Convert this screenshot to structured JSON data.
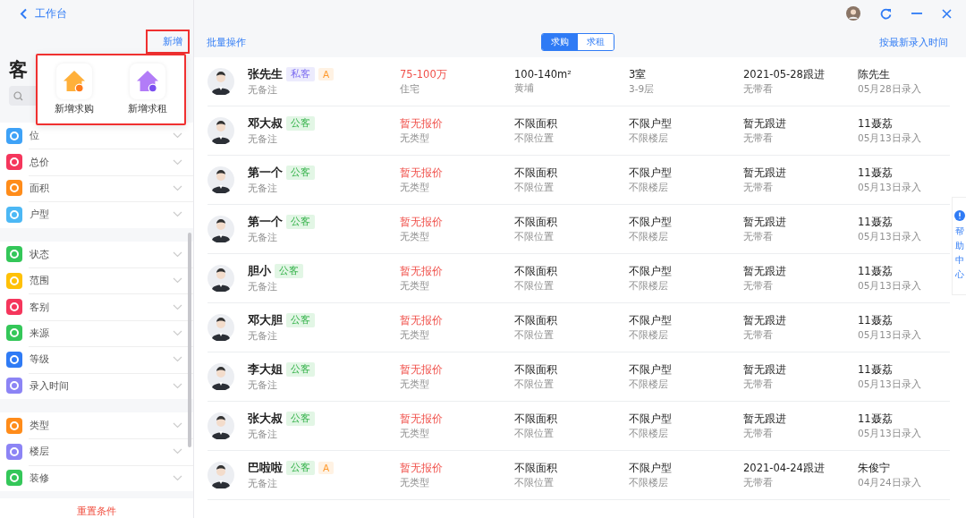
{
  "back": {
    "label": "工作台"
  },
  "sidebar": {
    "add_button": "新增",
    "title": "客",
    "filter_groups": [
      [
        {
          "label": "位",
          "color": "#3ea2f7"
        },
        {
          "label": "总价",
          "color": "#f5365c"
        },
        {
          "label": "面积",
          "color": "#ff8c1a"
        },
        {
          "label": "户型",
          "color": "#4cb8f5"
        }
      ],
      [
        {
          "label": "状态",
          "color": "#34c759"
        },
        {
          "label": "范围",
          "color": "#ffc107"
        },
        {
          "label": "客别",
          "color": "#f5365c"
        },
        {
          "label": "来源",
          "color": "#34c759"
        },
        {
          "label": "等级",
          "color": "#2f7bf5"
        },
        {
          "label": "录入时间",
          "color": "#8c84f5"
        }
      ],
      [
        {
          "label": "类型",
          "color": "#ff8c1a"
        },
        {
          "label": "楼层",
          "color": "#8c84f5"
        },
        {
          "label": "装修",
          "color": "#34c759"
        }
      ]
    ],
    "reset": "重置条件"
  },
  "popup": {
    "items": [
      {
        "label": "新增求购",
        "kind": "buy"
      },
      {
        "label": "新增求租",
        "kind": "rent"
      }
    ]
  },
  "toolbar": {
    "batch": "批量操作",
    "tabs": [
      {
        "label": "求购",
        "selected": true
      },
      {
        "label": "求租",
        "selected": false
      }
    ],
    "sort": "按最新录入时间"
  },
  "rows": [
    {
      "name": "张先生",
      "tags": [
        {
          "label": "私客",
          "kind": "private"
        },
        {
          "label": "A",
          "kind": "grade"
        }
      ],
      "note": "无备注",
      "price": "75-100万",
      "price_sub": "住宅",
      "area": "100-140m²",
      "area_sub": "黄埔",
      "rooms": "3室",
      "floors": "3-9层",
      "follow": "2021-05-28跟进",
      "follow_sub": "无带看",
      "owner": "陈先生",
      "date": "05月28日录入"
    },
    {
      "name": "邓大叔",
      "tags": [
        {
          "label": "公客",
          "kind": "public"
        }
      ],
      "note": "无备注",
      "price": "暂无报价",
      "price_sub": "无类型",
      "area": "不限面积",
      "area_sub": "不限位置",
      "rooms": "不限户型",
      "floors": "不限楼层",
      "follow": "暂无跟进",
      "follow_sub": "无带看",
      "owner": "11聂荔",
      "date": "05月13日录入"
    },
    {
      "name": "第一个",
      "tags": [
        {
          "label": "公客",
          "kind": "public"
        }
      ],
      "note": "无备注",
      "price": "暂无报价",
      "price_sub": "无类型",
      "area": "不限面积",
      "area_sub": "不限位置",
      "rooms": "不限户型",
      "floors": "不限楼层",
      "follow": "暂无跟进",
      "follow_sub": "无带看",
      "owner": "11聂荔",
      "date": "05月13日录入"
    },
    {
      "name": "第一个",
      "tags": [
        {
          "label": "公客",
          "kind": "public"
        }
      ],
      "note": "无备注",
      "price": "暂无报价",
      "price_sub": "无类型",
      "area": "不限面积",
      "area_sub": "不限位置",
      "rooms": "不限户型",
      "floors": "不限楼层",
      "follow": "暂无跟进",
      "follow_sub": "无带看",
      "owner": "11聂荔",
      "date": "05月13日录入"
    },
    {
      "name": "胆小",
      "tags": [
        {
          "label": "公客",
          "kind": "public"
        }
      ],
      "note": "无备注",
      "price": "暂无报价",
      "price_sub": "无类型",
      "area": "不限面积",
      "area_sub": "不限位置",
      "rooms": "不限户型",
      "floors": "不限楼层",
      "follow": "暂无跟进",
      "follow_sub": "无带看",
      "owner": "11聂荔",
      "date": "05月13日录入"
    },
    {
      "name": "邓大胆",
      "tags": [
        {
          "label": "公客",
          "kind": "public"
        }
      ],
      "note": "无备注",
      "price": "暂无报价",
      "price_sub": "无类型",
      "area": "不限面积",
      "area_sub": "不限位置",
      "rooms": "不限户型",
      "floors": "不限楼层",
      "follow": "暂无跟进",
      "follow_sub": "无带看",
      "owner": "11聂荔",
      "date": "05月13日录入"
    },
    {
      "name": "李大姐",
      "tags": [
        {
          "label": "公客",
          "kind": "public"
        }
      ],
      "note": "无备注",
      "price": "暂无报价",
      "price_sub": "无类型",
      "area": "不限面积",
      "area_sub": "不限位置",
      "rooms": "不限户型",
      "floors": "不限楼层",
      "follow": "暂无跟进",
      "follow_sub": "无带看",
      "owner": "11聂荔",
      "date": "05月13日录入"
    },
    {
      "name": "张大叔",
      "tags": [
        {
          "label": "公客",
          "kind": "public"
        }
      ],
      "note": "无备注",
      "price": "暂无报价",
      "price_sub": "无类型",
      "area": "不限面积",
      "area_sub": "不限位置",
      "rooms": "不限户型",
      "floors": "不限楼层",
      "follow": "暂无跟进",
      "follow_sub": "无带看",
      "owner": "11聂荔",
      "date": "05月13日录入"
    },
    {
      "name": "巴啦啦",
      "tags": [
        {
          "label": "公客",
          "kind": "public"
        },
        {
          "label": "A",
          "kind": "grade"
        }
      ],
      "note": "无备注",
      "price": "暂无报价",
      "price_sub": "无类型",
      "area": "不限面积",
      "area_sub": "不限位置",
      "rooms": "不限户型",
      "floors": "不限楼层",
      "follow": "2021-04-24跟进",
      "follow_sub": "无带看",
      "owner": "朱俊宁",
      "date": "04月24日录入"
    }
  ],
  "help": {
    "label": "帮助中心"
  }
}
